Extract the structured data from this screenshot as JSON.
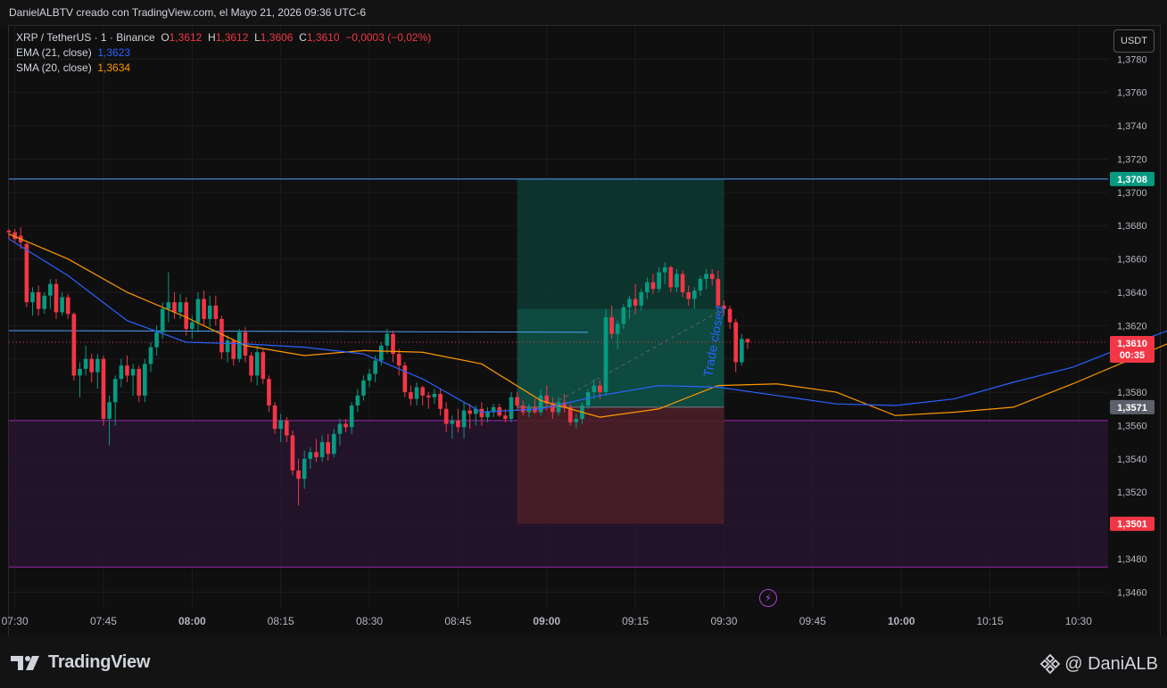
{
  "header": {
    "caption": "DanielALBTV creado con TradingView.com, el Mayo 21, 2026 09:36 UTC-6"
  },
  "legend": {
    "symbol": "XRP / TetherUS · 1 · Binance",
    "o_label": "O",
    "o_value": "1,3612",
    "h_label": "H",
    "h_value": "1,3612",
    "l_label": "L",
    "l_value": "1,3606",
    "c_label": "C",
    "c_value": "1,3610",
    "change": "−0,0003 (−0,02%)",
    "ema_label": "EMA (21, close)",
    "ema_value": "1,3623",
    "sma_label": "SMA (20, close)",
    "sma_value": "1,3634"
  },
  "currency_button": "USDT",
  "footer": {
    "brand": "TradingView",
    "author": "@ DaniALB"
  },
  "colors": {
    "up": "#089981",
    "down": "#f23645",
    "ema": "#2962ff",
    "sma": "#ff9800",
    "background": "#0f0f0f"
  },
  "chart_data": {
    "type": "candlestick",
    "symbol": "XRP / TetherUS",
    "interval": "1",
    "exchange": "Binance",
    "ylim": [
      1.345,
      1.38
    ],
    "yticks": [
      "1,3460",
      "1,3480",
      "1,3500",
      "1,3520",
      "1,3540",
      "1,3560",
      "1,3580",
      "1,3600",
      "1,3620",
      "1,3640",
      "1,3660",
      "1,3680",
      "1,3700",
      "1,3720",
      "1,3740",
      "1,3760",
      "1,3780"
    ],
    "xticks": [
      "07:30",
      "07:45",
      "08:00",
      "08:15",
      "08:30",
      "08:45",
      "09:00",
      "09:15",
      "09:30",
      "09:45",
      "10:00",
      "10:15",
      "10:30"
    ],
    "x_start": "07:29",
    "x_end": "10:35",
    "candles": [
      [
        1.3677,
        1.3678,
        1.3672,
        1.3676
      ],
      [
        1.3676,
        1.3678,
        1.367,
        1.3672
      ],
      [
        1.3674,
        1.3679,
        1.3666,
        1.367
      ],
      [
        1.3669,
        1.367,
        1.3631,
        1.3634
      ],
      [
        1.3634,
        1.3643,
        1.3626,
        1.364
      ],
      [
        1.364,
        1.3644,
        1.3626,
        1.363
      ],
      [
        1.363,
        1.364,
        1.3627,
        1.3638
      ],
      [
        1.3638,
        1.3648,
        1.363,
        1.3645
      ],
      [
        1.3645,
        1.3648,
        1.3624,
        1.3628
      ],
      [
        1.3628,
        1.364,
        1.3626,
        1.3637
      ],
      [
        1.3637,
        1.3639,
        1.3624,
        1.3627
      ],
      [
        1.3627,
        1.3628,
        1.3587,
        1.359
      ],
      [
        1.359,
        1.3598,
        1.3577,
        1.3594
      ],
      [
        1.3594,
        1.3608,
        1.359,
        1.36
      ],
      [
        1.36,
        1.3603,
        1.3586,
        1.3592
      ],
      [
        1.3592,
        1.3603,
        1.3582,
        1.36
      ],
      [
        1.36,
        1.3602,
        1.356,
        1.3564
      ],
      [
        1.3564,
        1.3578,
        1.3548,
        1.3574
      ],
      [
        1.3574,
        1.359,
        1.356,
        1.3588
      ],
      [
        1.3588,
        1.36,
        1.3583,
        1.3596
      ],
      [
        1.3596,
        1.3602,
        1.3586,
        1.359
      ],
      [
        1.359,
        1.3597,
        1.3578,
        1.3594
      ],
      [
        1.3594,
        1.3596,
        1.3574,
        1.3578
      ],
      [
        1.3578,
        1.36,
        1.3574,
        1.3597
      ],
      [
        1.3597,
        1.361,
        1.3592,
        1.3607
      ],
      [
        1.3607,
        1.362,
        1.3602,
        1.3616
      ],
      [
        1.3616,
        1.3634,
        1.3612,
        1.363
      ],
      [
        1.363,
        1.3652,
        1.3622,
        1.3634
      ],
      [
        1.3634,
        1.364,
        1.3624,
        1.3628
      ],
      [
        1.3628,
        1.3639,
        1.3624,
        1.3634
      ],
      [
        1.3634,
        1.3637,
        1.3614,
        1.3618
      ],
      [
        1.3618,
        1.3626,
        1.3612,
        1.3622
      ],
      [
        1.3622,
        1.364,
        1.3616,
        1.3636
      ],
      [
        1.3636,
        1.3641,
        1.362,
        1.3624
      ],
      [
        1.3624,
        1.3638,
        1.3619,
        1.3632
      ],
      [
        1.3632,
        1.3638,
        1.362,
        1.3624
      ],
      [
        1.3624,
        1.3626,
        1.36,
        1.3604
      ],
      [
        1.3604,
        1.3614,
        1.3598,
        1.3611
      ],
      [
        1.3611,
        1.3612,
        1.3596,
        1.36
      ],
      [
        1.36,
        1.3618,
        1.3598,
        1.3616
      ],
      [
        1.3616,
        1.3619,
        1.3598,
        1.3602
      ],
      [
        1.3602,
        1.3604,
        1.3586,
        1.359
      ],
      [
        1.359,
        1.3608,
        1.3584,
        1.3604
      ],
      [
        1.3604,
        1.3606,
        1.3585,
        1.3588
      ],
      [
        1.3588,
        1.359,
        1.3568,
        1.3572
      ],
      [
        1.3572,
        1.3574,
        1.3555,
        1.3558
      ],
      [
        1.3558,
        1.3567,
        1.355,
        1.3563
      ],
      [
        1.3563,
        1.3565,
        1.355,
        1.3554
      ],
      [
        1.3554,
        1.3557,
        1.353,
        1.3533
      ],
      [
        1.3533,
        1.354,
        1.3512,
        1.3528
      ],
      [
        1.3528,
        1.3545,
        1.3522,
        1.354
      ],
      [
        1.354,
        1.3547,
        1.3534,
        1.3544
      ],
      [
        1.3544,
        1.3552,
        1.3538,
        1.3541
      ],
      [
        1.3541,
        1.3554,
        1.3538,
        1.355
      ],
      [
        1.355,
        1.3555,
        1.3539,
        1.3543
      ],
      [
        1.3543,
        1.3558,
        1.3541,
        1.3555
      ],
      [
        1.3555,
        1.3564,
        1.3548,
        1.3561
      ],
      [
        1.3561,
        1.3564,
        1.3556,
        1.3559
      ],
      [
        1.3559,
        1.3574,
        1.3555,
        1.3572
      ],
      [
        1.3572,
        1.3582,
        1.3568,
        1.3578
      ],
      [
        1.3578,
        1.359,
        1.3575,
        1.3587
      ],
      [
        1.3587,
        1.3594,
        1.3583,
        1.3591
      ],
      [
        1.3591,
        1.3602,
        1.3586,
        1.3599
      ],
      [
        1.3599,
        1.361,
        1.3596,
        1.3608
      ],
      [
        1.3608,
        1.3618,
        1.3603,
        1.3615
      ],
      [
        1.3615,
        1.3617,
        1.3598,
        1.3603
      ],
      [
        1.3603,
        1.3606,
        1.359,
        1.3596
      ],
      [
        1.3596,
        1.3598,
        1.3577,
        1.358
      ],
      [
        1.358,
        1.3584,
        1.3572,
        1.3576
      ],
      [
        1.3576,
        1.3586,
        1.3572,
        1.3583
      ],
      [
        1.3583,
        1.3584,
        1.3572,
        1.3578
      ],
      [
        1.3578,
        1.358,
        1.357,
        1.3577
      ],
      [
        1.3577,
        1.3582,
        1.3573,
        1.3579
      ],
      [
        1.3579,
        1.3582,
        1.3566,
        1.357
      ],
      [
        1.357,
        1.3574,
        1.3556,
        1.3561
      ],
      [
        1.3561,
        1.3566,
        1.3552,
        1.3563
      ],
      [
        1.3563,
        1.357,
        1.3556,
        1.3559
      ],
      [
        1.3559,
        1.3574,
        1.3552,
        1.3569
      ],
      [
        1.3569,
        1.3573,
        1.3558,
        1.3567
      ],
      [
        1.3567,
        1.3572,
        1.356,
        1.357
      ],
      [
        1.357,
        1.3574,
        1.356,
        1.3565
      ],
      [
        1.3565,
        1.3571,
        1.3562,
        1.3568
      ],
      [
        1.3568,
        1.3573,
        1.3565,
        1.3571
      ],
      [
        1.3571,
        1.3573,
        1.3565,
        1.3566
      ],
      [
        1.3566,
        1.357,
        1.3562,
        1.3564
      ],
      [
        1.3564,
        1.358,
        1.3562,
        1.3577
      ],
      [
        1.3577,
        1.358,
        1.3569,
        1.3572
      ],
      [
        1.3572,
        1.3575,
        1.3566,
        1.3568
      ],
      [
        1.3568,
        1.3573,
        1.3565,
        1.3571
      ],
      [
        1.3571,
        1.3576,
        1.3567,
        1.3568
      ],
      [
        1.3568,
        1.3582,
        1.3566,
        1.3578
      ],
      [
        1.3578,
        1.3584,
        1.3569,
        1.3573
      ],
      [
        1.3573,
        1.3577,
        1.3564,
        1.3568
      ],
      [
        1.3568,
        1.3577,
        1.3566,
        1.3574
      ],
      [
        1.3574,
        1.3579,
        1.3568,
        1.3571
      ],
      [
        1.3571,
        1.3573,
        1.356,
        1.3562
      ],
      [
        1.3562,
        1.3567,
        1.3558,
        1.3564
      ],
      [
        1.3564,
        1.3574,
        1.3561,
        1.3572
      ],
      [
        1.3572,
        1.3582,
        1.357,
        1.358
      ],
      [
        1.358,
        1.3588,
        1.3576,
        1.3584
      ],
      [
        1.3584,
        1.3587,
        1.3576,
        1.358
      ],
      [
        1.358,
        1.363,
        1.3578,
        1.3625
      ],
      [
        1.3625,
        1.3632,
        1.3612,
        1.3615
      ],
      [
        1.3615,
        1.3623,
        1.3606,
        1.3621
      ],
      [
        1.3621,
        1.3633,
        1.3618,
        1.3631
      ],
      [
        1.3631,
        1.3638,
        1.3624,
        1.3636
      ],
      [
        1.3636,
        1.3645,
        1.3627,
        1.3632
      ],
      [
        1.3632,
        1.3642,
        1.3629,
        1.364
      ],
      [
        1.364,
        1.3649,
        1.3636,
        1.3646
      ],
      [
        1.3646,
        1.3651,
        1.3639,
        1.3642
      ],
      [
        1.3642,
        1.3655,
        1.364,
        1.3652
      ],
      [
        1.3652,
        1.3658,
        1.3645,
        1.3655
      ],
      [
        1.3655,
        1.3656,
        1.364,
        1.3643
      ],
      [
        1.3643,
        1.3654,
        1.364,
        1.3651
      ],
      [
        1.3651,
        1.3653,
        1.3637,
        1.364
      ],
      [
        1.364,
        1.3644,
        1.3632,
        1.3636
      ],
      [
        1.3636,
        1.3643,
        1.363,
        1.3641
      ],
      [
        1.3641,
        1.365,
        1.3638,
        1.3648
      ],
      [
        1.3648,
        1.3654,
        1.3642,
        1.3651
      ],
      [
        1.3651,
        1.3654,
        1.3644,
        1.3648
      ],
      [
        1.3648,
        1.3653,
        1.363,
        1.3632
      ],
      [
        1.3632,
        1.3635,
        1.3626,
        1.363
      ],
      [
        1.363,
        1.3632,
        1.3618,
        1.3622
      ],
      [
        1.3622,
        1.3624,
        1.3592,
        1.3598
      ],
      [
        1.3598,
        1.3615,
        1.3596,
        1.3612
      ],
      [
        1.3612,
        1.3612,
        1.3606,
        1.361
      ]
    ],
    "ema": {
      "name": "EMA (21, close)",
      "points": [
        [
          0,
          1.3672
        ],
        [
          10,
          1.365
        ],
        [
          20,
          1.3623
        ],
        [
          30,
          1.361
        ],
        [
          40,
          1.3609
        ],
        [
          50,
          1.3607
        ],
        [
          60,
          1.3603
        ],
        [
          70,
          1.3588
        ],
        [
          80,
          1.3568
        ],
        [
          90,
          1.357
        ],
        [
          100,
          1.3578
        ],
        [
          110,
          1.3584
        ],
        [
          120,
          1.3583
        ],
        [
          130,
          1.3578
        ],
        [
          140,
          1.3573
        ],
        [
          150,
          1.3572
        ],
        [
          160,
          1.3576
        ],
        [
          170,
          1.3586
        ],
        [
          180,
          1.3595
        ],
        [
          190,
          1.3609
        ],
        [
          200,
          1.3622
        ],
        [
          208,
          1.3629
        ],
        [
          216,
          1.3622
        ]
      ]
    },
    "sma": {
      "name": "SMA (20, close)",
      "points": [
        [
          0,
          1.3675
        ],
        [
          10,
          1.366
        ],
        [
          20,
          1.364
        ],
        [
          30,
          1.3625
        ],
        [
          40,
          1.3608
        ],
        [
          50,
          1.3602
        ],
        [
          60,
          1.3605
        ],
        [
          70,
          1.3604
        ],
        [
          80,
          1.3597
        ],
        [
          90,
          1.3575
        ],
        [
          100,
          1.3565
        ],
        [
          110,
          1.357
        ],
        [
          120,
          1.3584
        ],
        [
          130,
          1.3585
        ],
        [
          140,
          1.358
        ],
        [
          150,
          1.3566
        ],
        [
          160,
          1.3568
        ],
        [
          170,
          1.3571
        ],
        [
          180,
          1.3585
        ],
        [
          190,
          1.36
        ],
        [
          200,
          1.3615
        ],
        [
          208,
          1.3634
        ],
        [
          216,
          1.3634
        ]
      ]
    },
    "horizontal_lines": [
      {
        "price": 1.3708,
        "label": "1,3708",
        "color": "#4fa3f7",
        "label_bg": "#089981"
      },
      {
        "price": 1.3501,
        "label": "1,3501",
        "label_bg": "#f23645"
      }
    ],
    "current_price": {
      "label": "1,3610",
      "countdown": "00:35"
    },
    "ema_marker": "1,3623",
    "sma_marker": "1,3634",
    "entry_label": "1,3571",
    "position": {
      "type": "long",
      "entry": 1.3571,
      "take_profit": 1.3708,
      "stop": 1.3501,
      "start": "08:55",
      "end": "09:30"
    },
    "zones": [
      {
        "from": 1.3475,
        "to": 1.3563,
        "color": "#9c27b0"
      }
    ],
    "annotation": "Trade closed"
  }
}
